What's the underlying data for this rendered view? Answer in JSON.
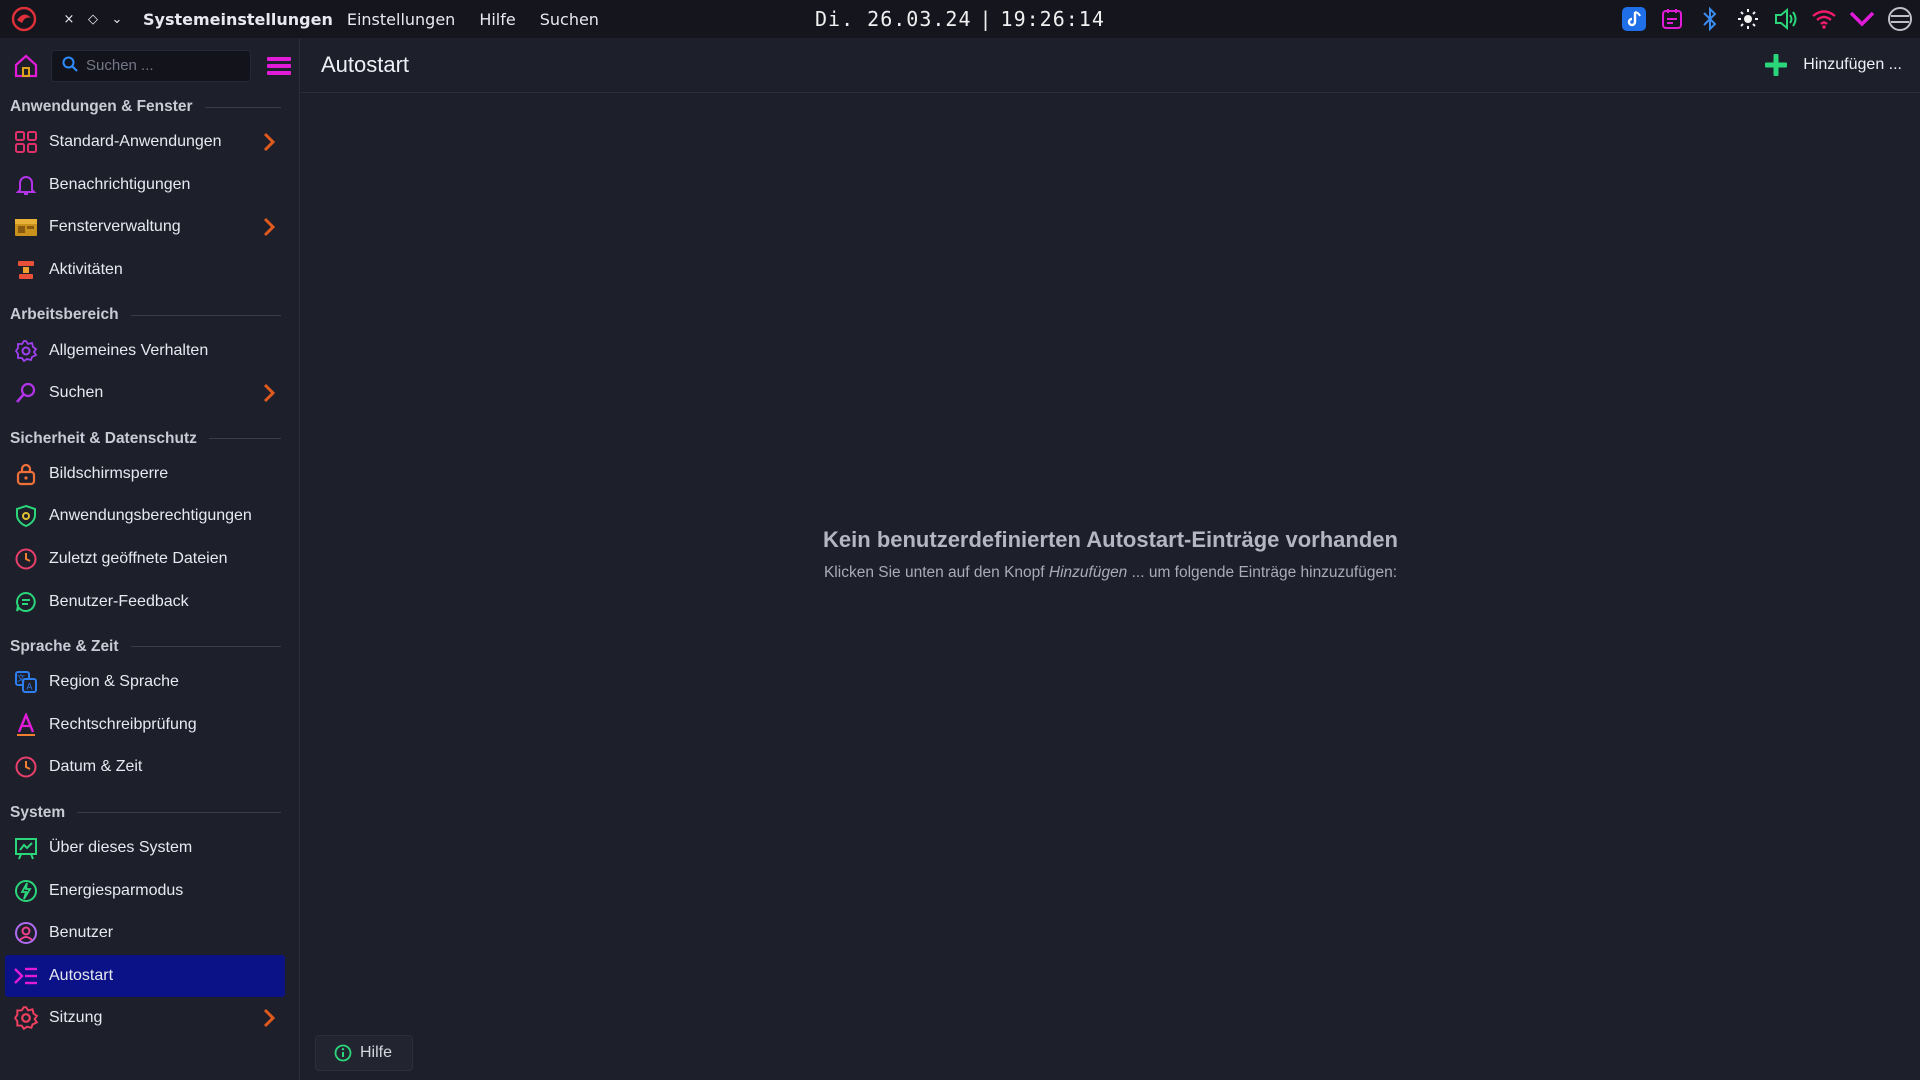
{
  "panel": {
    "window_controls": [
      "×",
      "◇",
      "⌄"
    ],
    "app_name": "Systemeinstellungen",
    "menus": [
      "Einstellungen",
      "Hilfe",
      "Suchen"
    ],
    "date": "Di. 26.03.24",
    "separator": "|",
    "time": "19:26:14",
    "tray_icons": [
      "app-icon",
      "calendar-icon",
      "bluetooth-icon",
      "brightness-icon",
      "volume-icon",
      "wifi-icon",
      "chevron-icon",
      "user-icon"
    ]
  },
  "toolbar": {
    "search_placeholder": "Suchen ...",
    "page_title": "Autostart",
    "add_label": "Hinzufügen ..."
  },
  "sidebar": {
    "categories": [
      {
        "label": "Anwendungen & Fenster",
        "items": [
          {
            "label": "Standard-Anwendungen",
            "icon": "apps-grid-icon",
            "chevron": true
          },
          {
            "label": "Benachrichtigungen",
            "icon": "bell-icon",
            "chevron": false
          },
          {
            "label": "Fensterverwaltung",
            "icon": "window-icon",
            "chevron": true
          },
          {
            "label": "Aktivitäten",
            "icon": "activities-icon",
            "chevron": false
          }
        ]
      },
      {
        "label": "Arbeitsbereich",
        "items": [
          {
            "label": "Allgemeines Verhalten",
            "icon": "gear-icon",
            "chevron": false
          },
          {
            "label": "Suchen",
            "icon": "magnifier-icon",
            "chevron": true
          }
        ]
      },
      {
        "label": "Sicherheit & Datenschutz",
        "items": [
          {
            "label": "Bildschirmsperre",
            "icon": "lock-icon",
            "chevron": false
          },
          {
            "label": "Anwendungsberechtigungen",
            "icon": "shield-icon",
            "chevron": false
          },
          {
            "label": "Zuletzt geöffnete Dateien",
            "icon": "clock-icon",
            "chevron": false
          },
          {
            "label": "Benutzer-Feedback",
            "icon": "feedback-icon",
            "chevron": false
          }
        ]
      },
      {
        "label": "Sprache & Zeit",
        "items": [
          {
            "label": "Region & Sprache",
            "icon": "language-icon",
            "chevron": false
          },
          {
            "label": "Rechtschreibprüfung",
            "icon": "spellcheck-icon",
            "chevron": false
          },
          {
            "label": "Datum & Zeit",
            "icon": "clock-icon",
            "chevron": false
          }
        ]
      },
      {
        "label": "System",
        "items": [
          {
            "label": "Über dieses System",
            "icon": "info-board-icon",
            "chevron": false
          },
          {
            "label": "Energiesparmodus",
            "icon": "power-icon",
            "chevron": false
          },
          {
            "label": "Benutzer",
            "icon": "user-icon",
            "chevron": false
          },
          {
            "label": "Autostart",
            "icon": "autostart-icon",
            "chevron": false,
            "active": true
          },
          {
            "label": "Sitzung",
            "icon": "session-gear-icon",
            "chevron": true
          }
        ]
      }
    ]
  },
  "content": {
    "empty_title": "Kein benutzerdefinierten Autostart-Einträge vorhanden",
    "empty_text_before": "Klicken Sie unten auf den Knopf ",
    "empty_text_em": "Hinzufügen",
    "empty_text_after": " ... um folgende Einträge hinzuzufügen:"
  },
  "footer": {
    "help_label": "Hilfe"
  },
  "colors": {
    "background": "#1d1f2b",
    "panel": "#14151d",
    "active_item": "#0b1287",
    "chevron": "#e05a1e",
    "accent_magenta": "#e21bd8",
    "accent_green": "#2bd67b"
  }
}
